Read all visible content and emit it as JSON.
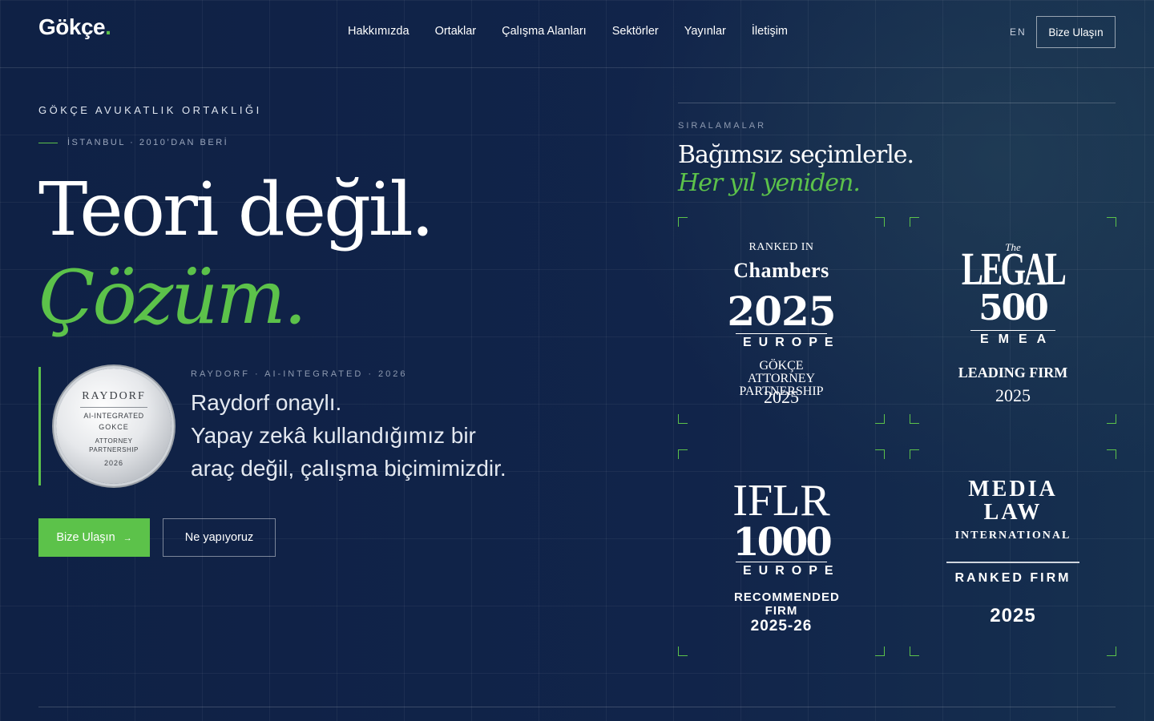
{
  "header": {
    "logo_text": "Gökçe",
    "logo_dot": ".",
    "nav": [
      {
        "label": "Hakkımızda"
      },
      {
        "label": "Ortaklar"
      },
      {
        "label": "Çalışma Alanları"
      },
      {
        "label": "Sektörler"
      },
      {
        "label": "Yayınlar"
      },
      {
        "label": "İletişim"
      }
    ],
    "lang": "EN",
    "cta": "Bize Ulaşın"
  },
  "hero": {
    "eyebrow": "GÖKÇE AVUKATLIK ORTAKLIĞI",
    "sub_eyebrow": "İSTANBUL · 2010’DAN BERİ",
    "headline": "Teori değil.",
    "headline_accent": "Çözüm.",
    "accent_color": "#5cc24a"
  },
  "raydorf": {
    "seal": {
      "title": "RAYDORF",
      "line1": "AI-INTEGRATED",
      "line2": "GOKCE",
      "line3": "ATTORNEY",
      "line4": "PARTNERSHIP",
      "year": "2026"
    },
    "label": "RAYDORF · AI-INTEGRATED · 2026",
    "text_line1": "Raydorf onaylı.",
    "text_line2": "Yapay zekâ kullandığımız bir",
    "text_line3": "araç değil, çalışma biçimimizdir."
  },
  "buttons": {
    "primary": "Bize Ulaşın",
    "primary_arrow": "→",
    "secondary": "Ne yapıyoruz"
  },
  "rankings": {
    "eyebrow": "SIRALAMALAR",
    "title": "Bağımsız seçimlerle.",
    "subtitle": "Her yıl yeniden.",
    "chambers": {
      "ranked_in": "RANKED IN",
      "name": "Chambers",
      "year": "2025",
      "region": "EUROPE",
      "firm": "GÖKÇE ATTORNEY PARTNERSHIP",
      "firm_year": "2025"
    },
    "legal500": {
      "the": "The",
      "legal": "LEGAL",
      "number": "500",
      "region": "EMEA",
      "status": "LEADING FIRM",
      "year": "2025"
    },
    "iflr": {
      "name": "IFLR",
      "number": "1000",
      "region": "EUROPE",
      "status": "RECOMMENDED FIRM",
      "year": "2025-26"
    },
    "media_law": {
      "line1": "MEDIA",
      "line2": "LAW",
      "line3": "INTERNATIONAL",
      "status": "RANKED FIRM",
      "year": "2025"
    }
  }
}
